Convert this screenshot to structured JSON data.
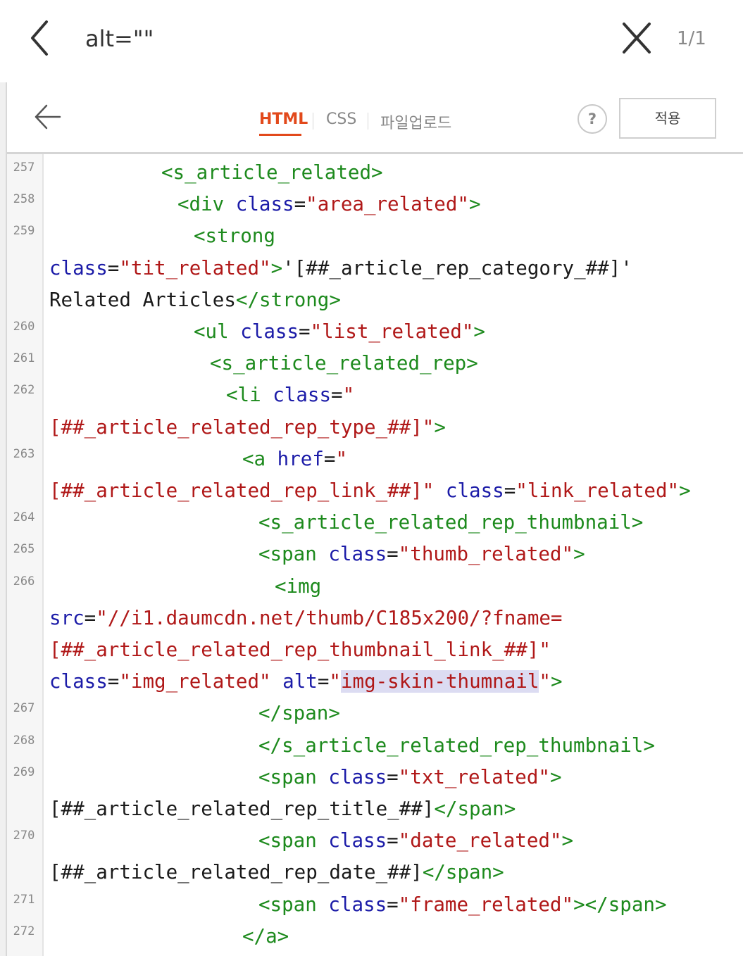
{
  "find_bar": {
    "query": "alt=\"\"",
    "match_count": "1/1",
    "back_icon": "chevron-left-icon",
    "close_icon": "close-icon"
  },
  "toolbar": {
    "back_icon": "arrow-left-icon",
    "tabs": [
      {
        "label": "HTML",
        "active": true
      },
      {
        "label": "CSS",
        "active": false
      },
      {
        "label": "파일업로드",
        "active": false
      }
    ],
    "help_label": "?",
    "apply_label": "적용",
    "accent_color": "#e2491b"
  },
  "editor": {
    "line_numbers": [
      "257",
      "258",
      "259",
      "260",
      "261",
      "262",
      "263",
      "264",
      "265",
      "266",
      "267",
      "268",
      "269",
      "270",
      "271",
      "272"
    ],
    "lines": [
      {
        "tokens": [
          {
            "k": "t",
            "v": "<s_article_related>"
          }
        ]
      },
      {
        "tokens": [
          {
            "k": "t",
            "v": "<div "
          },
          {
            "k": "a",
            "v": "class"
          },
          {
            "k": "p",
            "v": "="
          },
          {
            "k": "s",
            "v": "\"area_related\""
          },
          {
            "k": "t",
            "v": ">"
          }
        ]
      },
      {
        "tokens": [
          {
            "k": "t",
            "v": "<strong"
          }
        ]
      },
      {
        "tokens": [
          {
            "k": "a",
            "v": "class"
          },
          {
            "k": "p",
            "v": "="
          },
          {
            "k": "s",
            "v": "\"tit_related\""
          },
          {
            "k": "t",
            "v": ">"
          },
          {
            "k": "p",
            "v": "'[##_article_rep_category_##]'"
          }
        ]
      },
      {
        "tokens": [
          {
            "k": "p",
            "v": "Related Articles"
          },
          {
            "k": "t",
            "v": "</strong>"
          }
        ]
      },
      {
        "tokens": [
          {
            "k": "t",
            "v": "<ul "
          },
          {
            "k": "a",
            "v": "class"
          },
          {
            "k": "p",
            "v": "="
          },
          {
            "k": "s",
            "v": "\"list_related\""
          },
          {
            "k": "t",
            "v": ">"
          }
        ]
      },
      {
        "tokens": [
          {
            "k": "t",
            "v": "<s_article_related_rep>"
          }
        ]
      },
      {
        "tokens": [
          {
            "k": "t",
            "v": "<li "
          },
          {
            "k": "a",
            "v": "class"
          },
          {
            "k": "p",
            "v": "="
          },
          {
            "k": "s",
            "v": "\""
          }
        ]
      },
      {
        "tokens": [
          {
            "k": "s",
            "v": "[##_article_related_rep_type_##]\""
          },
          {
            "k": "t",
            "v": ">"
          }
        ]
      },
      {
        "tokens": [
          {
            "k": "t",
            "v": "<a "
          },
          {
            "k": "a",
            "v": "href"
          },
          {
            "k": "p",
            "v": "="
          },
          {
            "k": "s",
            "v": "\""
          }
        ]
      },
      {
        "tokens": [
          {
            "k": "s",
            "v": "[##_article_related_rep_link_##]\" "
          },
          {
            "k": "a",
            "v": "class"
          },
          {
            "k": "p",
            "v": "="
          },
          {
            "k": "s",
            "v": "\"link_related\""
          },
          {
            "k": "t",
            "v": ">"
          }
        ]
      },
      {
        "tokens": [
          {
            "k": "t",
            "v": "<s_article_related_rep_thumbnail>"
          }
        ]
      },
      {
        "tokens": [
          {
            "k": "t",
            "v": "<span "
          },
          {
            "k": "a",
            "v": "class"
          },
          {
            "k": "p",
            "v": "="
          },
          {
            "k": "s",
            "v": "\"thumb_related\""
          },
          {
            "k": "t",
            "v": ">"
          }
        ]
      },
      {
        "tokens": [
          {
            "k": "t",
            "v": "<img"
          }
        ]
      },
      {
        "tokens": [
          {
            "k": "a",
            "v": "src"
          },
          {
            "k": "p",
            "v": "="
          },
          {
            "k": "s",
            "v": "\"//i1.daumcdn.net/thumb/C185x200/?fname="
          }
        ]
      },
      {
        "tokens": [
          {
            "k": "s",
            "v": "[##_article_related_rep_thumbnail_link_##]\""
          }
        ]
      },
      {
        "tokens": [
          {
            "k": "a",
            "v": "class"
          },
          {
            "k": "p",
            "v": "="
          },
          {
            "k": "s",
            "v": "\"img_related\" "
          },
          {
            "k": "a",
            "v": "alt"
          },
          {
            "k": "p",
            "v": "="
          },
          {
            "k": "s",
            "v": "\""
          },
          {
            "k": "s",
            "v": "img-skin-thumnail",
            "hl": true
          },
          {
            "k": "s",
            "v": "\""
          },
          {
            "k": "t",
            "v": ">"
          }
        ]
      },
      {
        "tokens": [
          {
            "k": "t",
            "v": "</span>"
          }
        ]
      },
      {
        "tokens": [
          {
            "k": "t",
            "v": "</s_article_related_rep_thumbnail>"
          }
        ]
      },
      {
        "tokens": [
          {
            "k": "t",
            "v": "<span "
          },
          {
            "k": "a",
            "v": "class"
          },
          {
            "k": "p",
            "v": "="
          },
          {
            "k": "s",
            "v": "\"txt_related\""
          },
          {
            "k": "t",
            "v": ">"
          }
        ]
      },
      {
        "tokens": [
          {
            "k": "p",
            "v": "[##_article_related_rep_title_##]"
          },
          {
            "k": "t",
            "v": "</span>"
          }
        ]
      },
      {
        "tokens": [
          {
            "k": "t",
            "v": "<span "
          },
          {
            "k": "a",
            "v": "class"
          },
          {
            "k": "p",
            "v": "="
          },
          {
            "k": "s",
            "v": "\"date_related\""
          },
          {
            "k": "t",
            "v": ">"
          }
        ]
      },
      {
        "tokens": [
          {
            "k": "p",
            "v": "[##_article_related_rep_date_##]"
          },
          {
            "k": "t",
            "v": "</span>"
          }
        ]
      },
      {
        "tokens": [
          {
            "k": "t",
            "v": "<span "
          },
          {
            "k": "a",
            "v": "class"
          },
          {
            "k": "p",
            "v": "="
          },
          {
            "k": "s",
            "v": "\"frame_related\""
          },
          {
            "k": "t",
            "v": "></span>"
          }
        ]
      },
      {
        "tokens": [
          {
            "k": "t",
            "v": "</a>"
          }
        ]
      }
    ]
  }
}
